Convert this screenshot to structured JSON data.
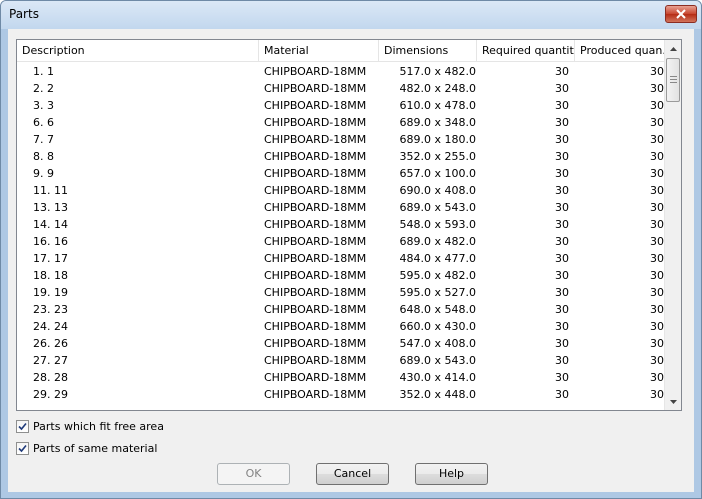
{
  "window": {
    "title": "Parts"
  },
  "table": {
    "columns": [
      "Description",
      "Material",
      "Dimensions",
      "Required quantity",
      "Produced quan..."
    ],
    "rows": [
      [
        "1. 1",
        "CHIPBOARD-18MM",
        "517.0 x 482.0",
        "30",
        "30"
      ],
      [
        "2. 2",
        "CHIPBOARD-18MM",
        "482.0 x 248.0",
        "30",
        "30"
      ],
      [
        "3. 3",
        "CHIPBOARD-18MM",
        "610.0 x 478.0",
        "30",
        "30"
      ],
      [
        "6. 6",
        "CHIPBOARD-18MM",
        "689.0 x 348.0",
        "30",
        "30"
      ],
      [
        "7. 7",
        "CHIPBOARD-18MM",
        "689.0 x 180.0",
        "30",
        "30"
      ],
      [
        "8. 8",
        "CHIPBOARD-18MM",
        "352.0 x 255.0",
        "30",
        "30"
      ],
      [
        "9. 9",
        "CHIPBOARD-18MM",
        "657.0 x 100.0",
        "30",
        "30"
      ],
      [
        "11. 11",
        "CHIPBOARD-18MM",
        "690.0 x 408.0",
        "30",
        "30"
      ],
      [
        "13. 13",
        "CHIPBOARD-18MM",
        "689.0 x 543.0",
        "30",
        "30"
      ],
      [
        "14. 14",
        "CHIPBOARD-18MM",
        "548.0 x 593.0",
        "30",
        "30"
      ],
      [
        "16. 16",
        "CHIPBOARD-18MM",
        "689.0 x 482.0",
        "30",
        "30"
      ],
      [
        "17. 17",
        "CHIPBOARD-18MM",
        "484.0 x 477.0",
        "30",
        "30"
      ],
      [
        "18. 18",
        "CHIPBOARD-18MM",
        "595.0 x 482.0",
        "30",
        "30"
      ],
      [
        "19. 19",
        "CHIPBOARD-18MM",
        "595.0 x 527.0",
        "30",
        "30"
      ],
      [
        "23. 23",
        "CHIPBOARD-18MM",
        "648.0 x 548.0",
        "30",
        "30"
      ],
      [
        "24. 24",
        "CHIPBOARD-18MM",
        "660.0 x 430.0",
        "30",
        "30"
      ],
      [
        "26. 26",
        "CHIPBOARD-18MM",
        "547.0 x 408.0",
        "30",
        "30"
      ],
      [
        "27. 27",
        "CHIPBOARD-18MM",
        "689.0 x 543.0",
        "30",
        "30"
      ],
      [
        "28. 28",
        "CHIPBOARD-18MM",
        "430.0 x 414.0",
        "30",
        "30"
      ],
      [
        "29. 29",
        "CHIPBOARD-18MM",
        "352.0 x 448.0",
        "30",
        "30"
      ]
    ]
  },
  "options": {
    "fit_free_area": {
      "label": "Parts which fit free area",
      "checked": true
    },
    "same_material": {
      "label": "Parts of same material",
      "checked": true
    }
  },
  "buttons": {
    "ok": "OK",
    "cancel": "Cancel",
    "help": "Help"
  }
}
